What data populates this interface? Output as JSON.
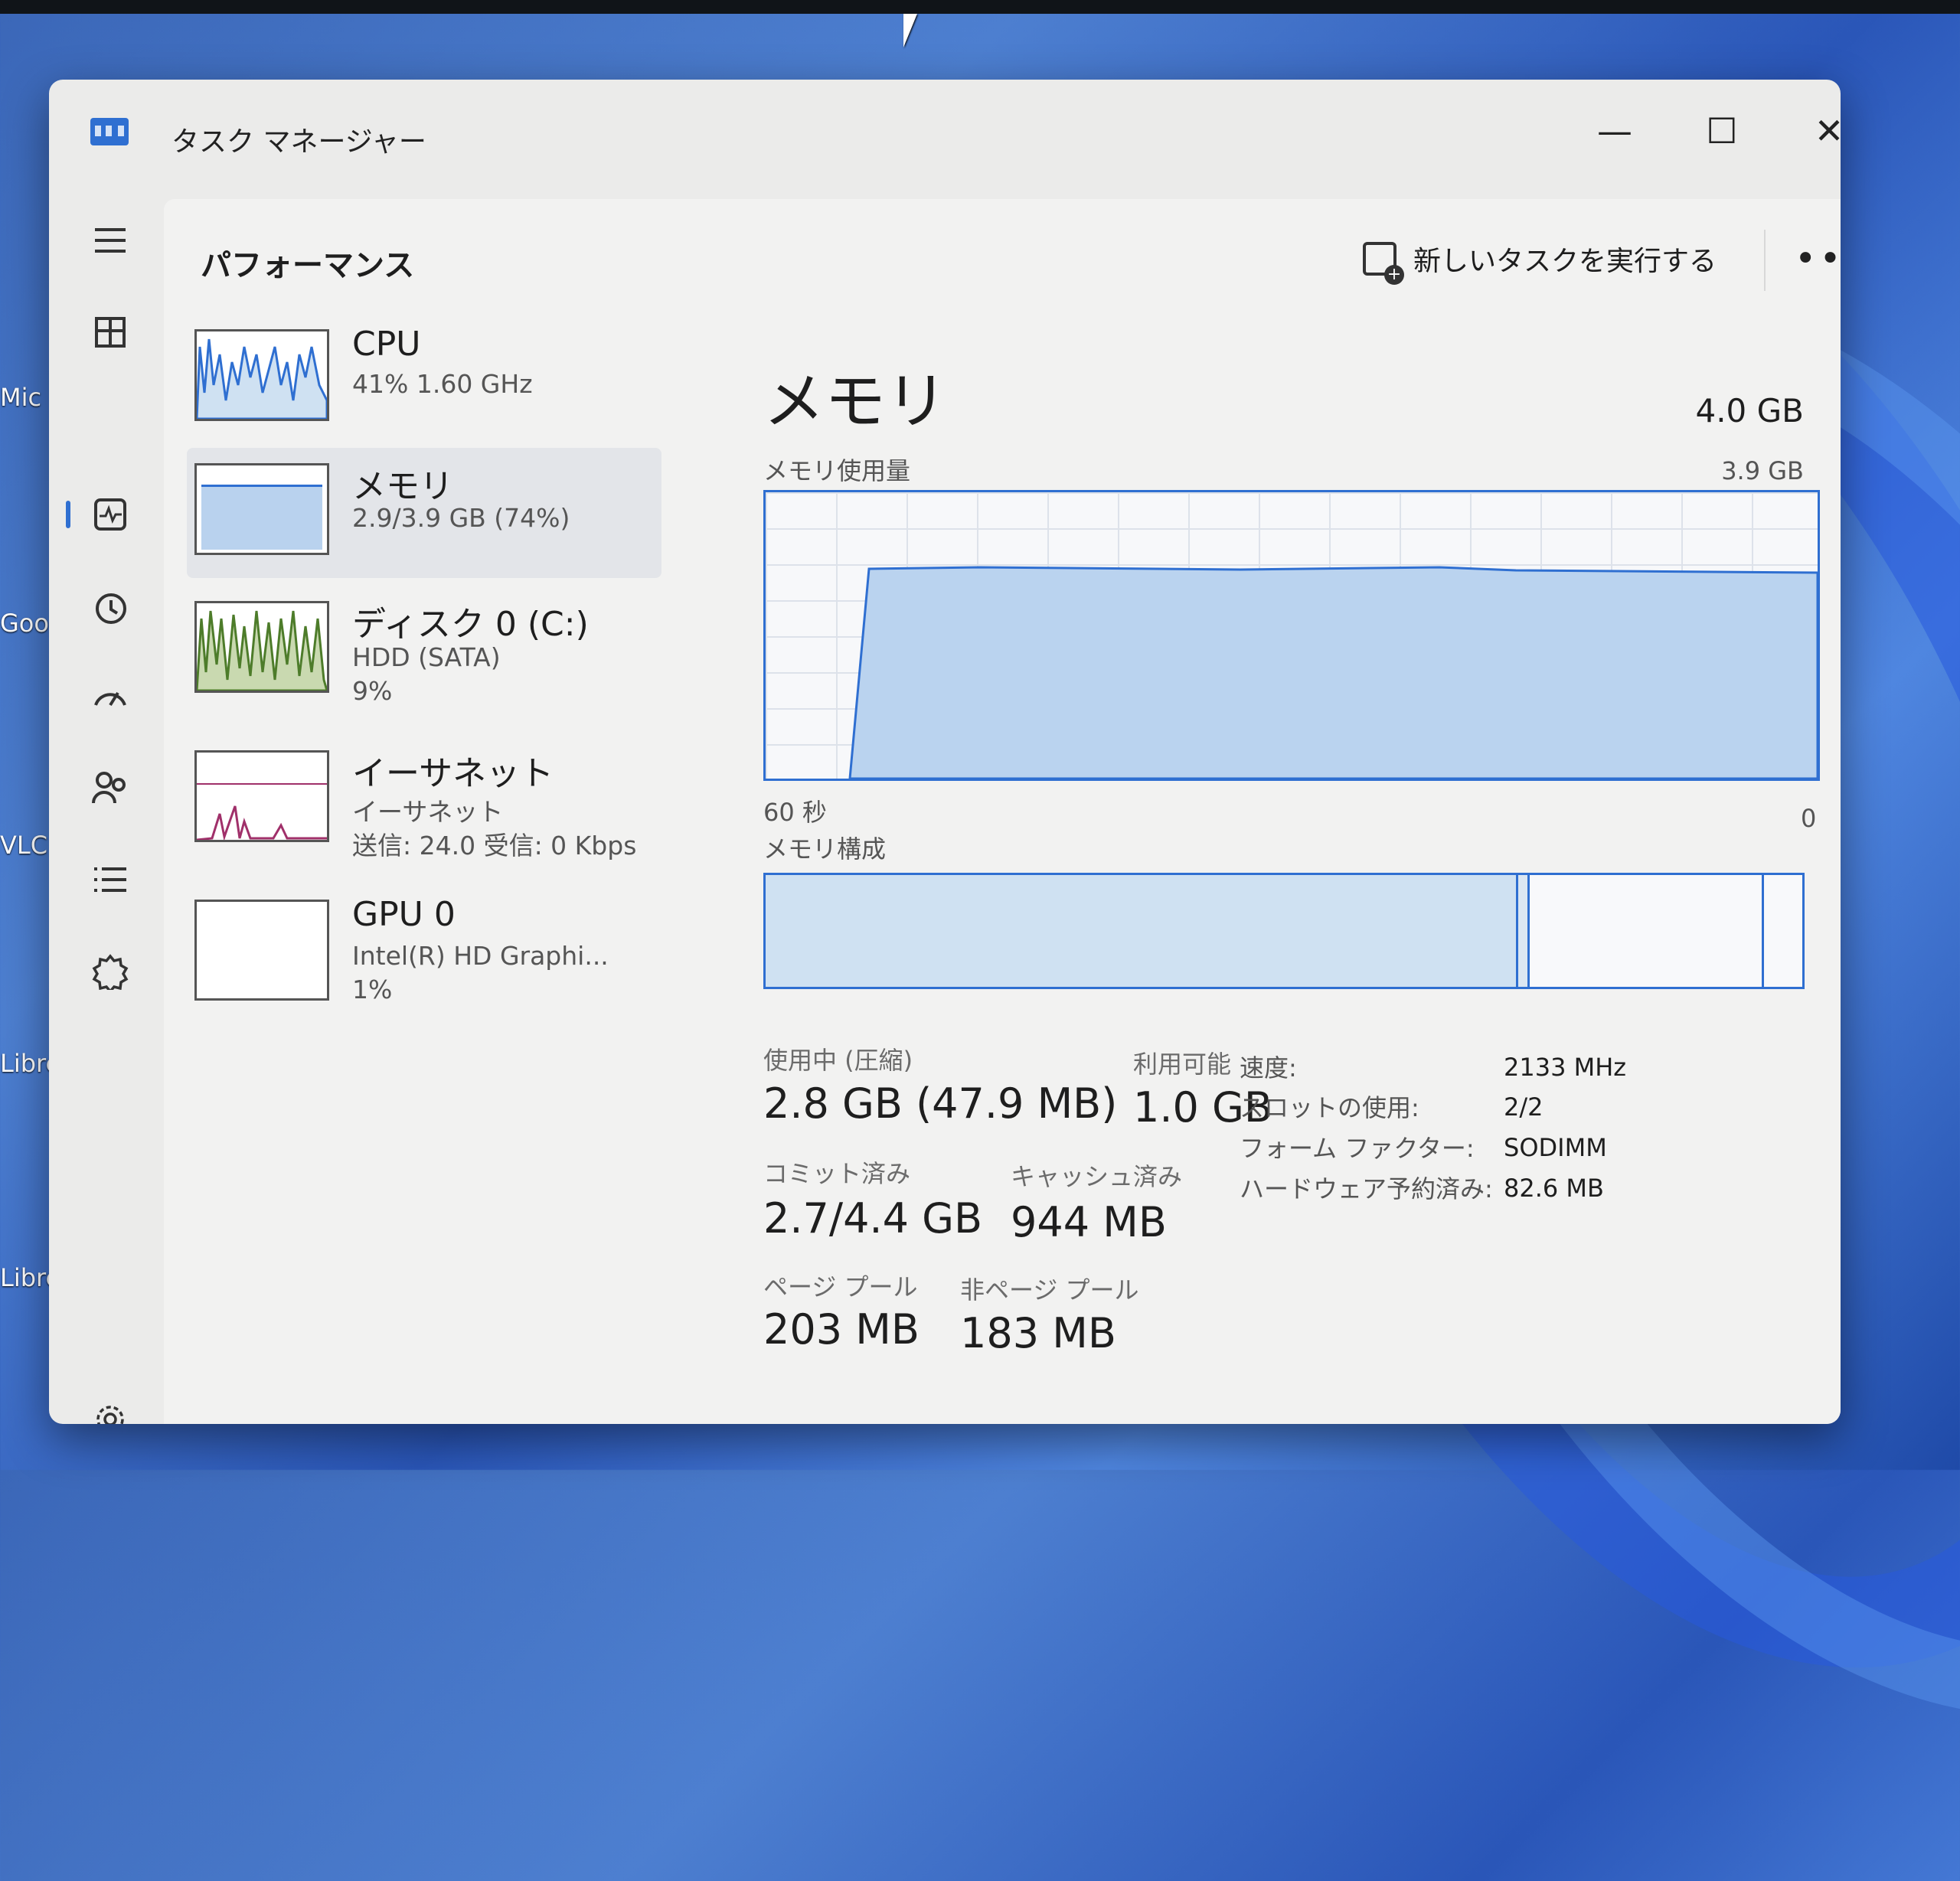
{
  "desktop": {
    "icon_labels": [
      "Mic",
      "Goo",
      "VLC r",
      "Libre",
      "Libre"
    ]
  },
  "window": {
    "title": "タスク マネージャー",
    "controls": {
      "minimize": "—",
      "maximize": "☐",
      "close": "✕"
    }
  },
  "header": {
    "page_title": "パフォーマンス",
    "new_task_label": "新しいタスクを実行する",
    "more": "•••"
  },
  "nav": {
    "icons": [
      "hamburger-icon",
      "processes-icon",
      "performance-icon",
      "app-history-icon",
      "startup-icon",
      "users-icon",
      "details-icon",
      "services-icon",
      "settings-icon"
    ],
    "selected": "performance-icon"
  },
  "perf_list": [
    {
      "name": "CPU",
      "sub1": "41%  1.60 GHz",
      "sub2": "",
      "sub3": ""
    },
    {
      "name": "メモリ",
      "sub1": "2.9/3.9 GB (74%)",
      "sub2": "",
      "sub3": ""
    },
    {
      "name": "ディスク 0 (C:)",
      "sub1": "HDD (SATA)",
      "sub2": "9%",
      "sub3": ""
    },
    {
      "name": "イーサネット",
      "sub1": "イーサネット",
      "sub2": "送信: 24.0  受信: 0 Kbps",
      "sub3": ""
    },
    {
      "name": "GPU 0",
      "sub1": "Intel(R) HD Graphi...",
      "sub2": "1%",
      "sub3": ""
    }
  ],
  "memory": {
    "title": "メモリ",
    "total": "4.0 GB",
    "usage_label": "メモリ使用量",
    "usage_max": "3.9 GB",
    "axis_left": "60 秒",
    "axis_right": "0",
    "composition_label": "メモリ構成",
    "usage_fraction": 0.74
  },
  "stats": {
    "in_use_label": "使用中 (圧縮)",
    "in_use_value": "2.8 GB (47.9 MB)",
    "available_label": "利用可能",
    "available_value": "1.0 GB",
    "committed_label": "コミット済み",
    "committed_value": "2.7/4.4 GB",
    "cached_label": "キャッシュ済み",
    "cached_value": "944 MB",
    "paged_label": "ページ プール",
    "paged_value": "203 MB",
    "nonpaged_label": "非ページ プール",
    "nonpaged_value": "183 MB"
  },
  "specs": {
    "speed_label": "速度:",
    "speed_value": "2133 MHz",
    "slots_label": "スロットの使用:",
    "slots_value": "2/2",
    "form_label": "フォーム ファクター:",
    "form_value": "SODIMM",
    "reserved_label": "ハードウェア予約済み:",
    "reserved_value": "82.6 MB"
  },
  "colors": {
    "accent": "#2f6fd1",
    "disk": "#4d7c2a",
    "ethernet": "#a0306a"
  }
}
